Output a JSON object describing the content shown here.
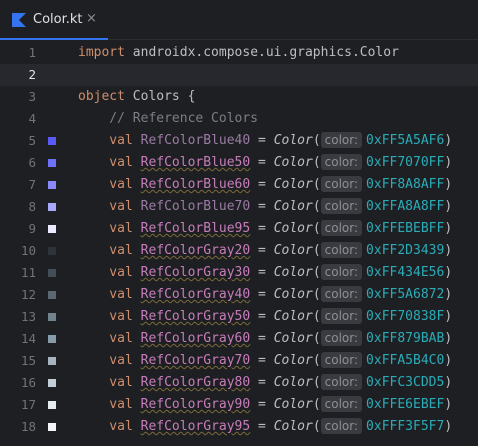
{
  "tab": {
    "label": "Color.kt",
    "close": "×",
    "icon": "kotlin-file-icon",
    "accent": "#3574f0"
  },
  "editor": {
    "current_line": 2,
    "lines": [
      {
        "n": "1",
        "kind": "import",
        "kw": "import",
        "text": "androidx.compose.ui.graphics.Color"
      },
      {
        "n": "2",
        "kind": "blank"
      },
      {
        "n": "3",
        "kind": "object",
        "kw": "object",
        "text": "Colors {"
      },
      {
        "n": "4",
        "kind": "comment",
        "text": "// Reference Colors"
      },
      {
        "n": "5",
        "kind": "val",
        "kw": "val",
        "name": "RefColorBlue40",
        "plain": true,
        "eq": " = ",
        "fn": "Color",
        "paren": "(",
        "hint": "color:",
        "value": "0xFF5A5AF6",
        "close": ")",
        "swatch": "#5a5af6"
      },
      {
        "n": "6",
        "kind": "val",
        "kw": "val",
        "name": "RefColorBlue50",
        "plain": false,
        "eq": " = ",
        "fn": "Color",
        "paren": "(",
        "hint": "color:",
        "value": "0xFF7070FF",
        "close": ")",
        "swatch": "#7070ff"
      },
      {
        "n": "7",
        "kind": "val",
        "kw": "val",
        "name": "RefColorBlue60",
        "plain": false,
        "eq": " = ",
        "fn": "Color",
        "paren": "(",
        "hint": "color:",
        "value": "0xFF8A8AFF",
        "close": ")",
        "swatch": "#8a8aff"
      },
      {
        "n": "8",
        "kind": "val",
        "kw": "val",
        "name": "RefColorBlue70",
        "plain": true,
        "eq": " = ",
        "fn": "Color",
        "paren": "(",
        "hint": "color:",
        "value": "0xFFA8A8FF",
        "close": ")",
        "swatch": "#a8a8ff"
      },
      {
        "n": "9",
        "kind": "val",
        "kw": "val",
        "name": "RefColorBlue95",
        "plain": false,
        "eq": " = ",
        "fn": "Color",
        "paren": "(",
        "hint": "color:",
        "value": "0xFFEBEBFF",
        "close": ")",
        "swatch": "#ebebff"
      },
      {
        "n": "10",
        "kind": "val",
        "kw": "val",
        "name": "RefColorGray20",
        "plain": false,
        "eq": " = ",
        "fn": "Color",
        "paren": "(",
        "hint": "color:",
        "value": "0xFF2D3439",
        "close": ")",
        "swatch": "#2d3439"
      },
      {
        "n": "11",
        "kind": "val",
        "kw": "val",
        "name": "RefColorGray30",
        "plain": false,
        "eq": " = ",
        "fn": "Color",
        "paren": "(",
        "hint": "color:",
        "value": "0xFF434E56",
        "close": ")",
        "swatch": "#434e56"
      },
      {
        "n": "12",
        "kind": "val",
        "kw": "val",
        "name": "RefColorGray40",
        "plain": false,
        "eq": " = ",
        "fn": "Color",
        "paren": "(",
        "hint": "color:",
        "value": "0xFF5A6872",
        "close": ")",
        "swatch": "#5a6872"
      },
      {
        "n": "13",
        "kind": "val",
        "kw": "val",
        "name": "RefColorGray50",
        "plain": false,
        "eq": " = ",
        "fn": "Color",
        "paren": "(",
        "hint": "color:",
        "value": "0xFF70838F",
        "close": ")",
        "swatch": "#70838f"
      },
      {
        "n": "14",
        "kind": "val",
        "kw": "val",
        "name": "RefColorGray60",
        "plain": false,
        "eq": " = ",
        "fn": "Color",
        "paren": "(",
        "hint": "color:",
        "value": "0xFF879BAB",
        "close": ")",
        "swatch": "#879bab"
      },
      {
        "n": "15",
        "kind": "val",
        "kw": "val",
        "name": "RefColorGray70",
        "plain": false,
        "eq": " = ",
        "fn": "Color",
        "paren": "(",
        "hint": "color:",
        "value": "0xFFA5B4C0",
        "close": ")",
        "swatch": "#a5b4c0"
      },
      {
        "n": "16",
        "kind": "val",
        "kw": "val",
        "name": "RefColorGray80",
        "plain": false,
        "eq": " = ",
        "fn": "Color",
        "paren": "(",
        "hint": "color:",
        "value": "0xFFC3CDD5",
        "close": ")",
        "swatch": "#c3cdd5"
      },
      {
        "n": "17",
        "kind": "val",
        "kw": "val",
        "name": "RefColorGray90",
        "plain": false,
        "eq": " = ",
        "fn": "Color",
        "paren": "(",
        "hint": "color:",
        "value": "0xFFE6EBEF",
        "close": ")",
        "swatch": "#e6ebef"
      },
      {
        "n": "18",
        "kind": "val",
        "kw": "val",
        "name": "RefColorGray95",
        "plain": false,
        "eq": " = ",
        "fn": "Color",
        "paren": "(",
        "hint": "color:",
        "value": "0xFFF3F5F7",
        "close": ")",
        "swatch": "#f3f5f7"
      }
    ]
  }
}
